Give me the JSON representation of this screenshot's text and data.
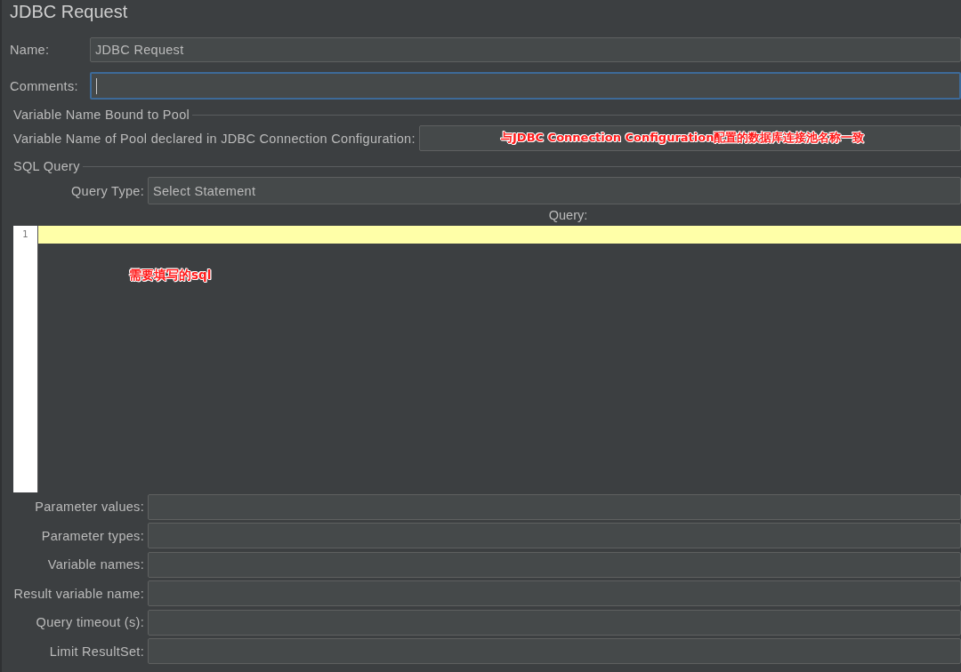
{
  "window": {
    "title": "JDBC Request"
  },
  "name_field": {
    "label": "Name:",
    "value": "JDBC Request"
  },
  "comments_field": {
    "label": "Comments:",
    "focused": true
  },
  "pool_section": {
    "title": "Variable Name Bound to Pool",
    "label": "Variable Name of Pool declared in JDBC Connection Configuration:",
    "annotation": "与JDBC Connection Configuration配置的数据库连接池名称一致"
  },
  "sql_section": {
    "title": "SQL Query",
    "query_type": {
      "label": "Query Type:",
      "value": "Select Statement"
    },
    "query_label": "Query:",
    "line_numbers": [
      "1"
    ],
    "annotation": "需要填写的sql"
  },
  "parameter_fields": [
    {
      "label": "Parameter values:"
    },
    {
      "label": "Parameter types:"
    },
    {
      "label": "Variable names:"
    },
    {
      "label": "Result variable name:"
    },
    {
      "label": "Query timeout (s):"
    },
    {
      "label": "Limit ResultSet:"
    }
  ]
}
